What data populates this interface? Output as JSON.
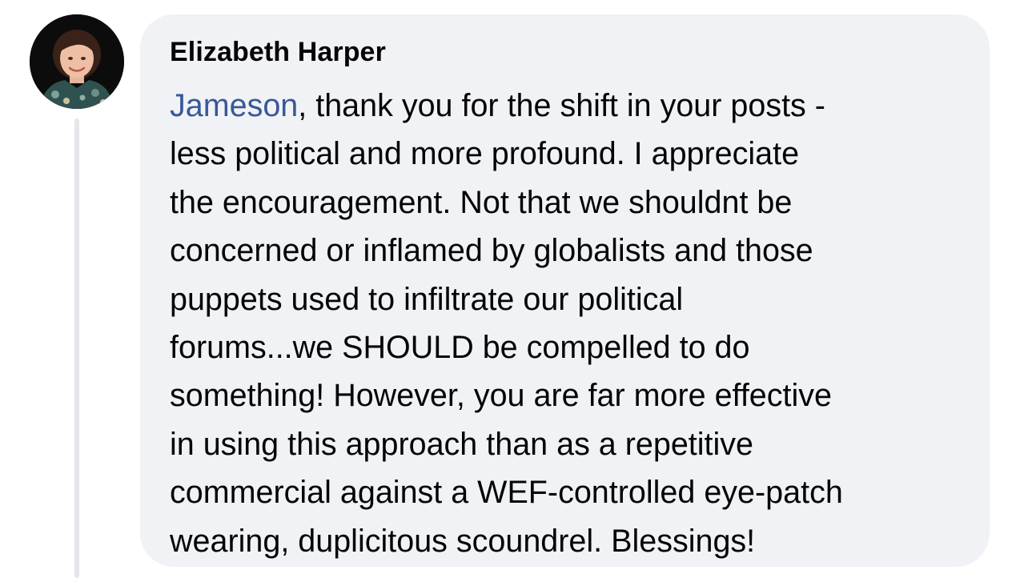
{
  "comment": {
    "author": "Elizabeth Harper",
    "mention": "Jameson",
    "text": ", thank you for the shift in your posts -\nless political and more profound.  I appreciate\nthe encouragement.  Not that we shouldnt be\nconcerned or inflamed by globalists and those\npuppets used to infiltrate our political\nforums...we SHOULD be compelled to do\nsomething!  However, you are far more effective\nin using this approach than as a repetitive\ncommercial against a WEF-controlled eye-patch\nwearing, duplicitous scoundrel.  Blessings!"
  },
  "colors": {
    "bubble": "#f0f2f5",
    "mention": "#385898",
    "text": "#050505",
    "thread_line": "#e4e6eb"
  },
  "icons": {
    "avatar": "profile-photo"
  }
}
